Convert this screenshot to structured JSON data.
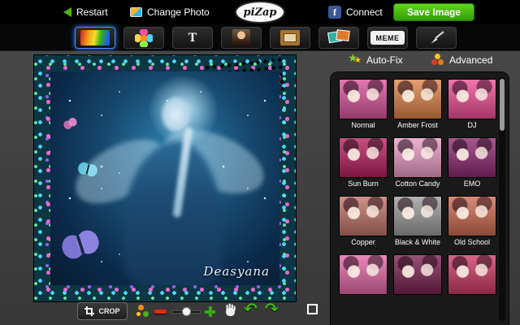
{
  "topbar": {
    "restart_label": "Restart",
    "change_photo_label": "Change Photo",
    "logo_text": "piZap",
    "facebook_letter": "f",
    "connect_label": "Connect",
    "save_label": "Save Image"
  },
  "toolbar": {
    "text_letter": "T",
    "meme_label": "MEME"
  },
  "canvas": {
    "signature": "Deasyana"
  },
  "effects_panel": {
    "autofix_label": "Auto-Fix",
    "advanced_label": "Advanced",
    "star_glyph": "★",
    "filters": [
      {
        "name": "Normal",
        "tint": "#d9549b"
      },
      {
        "name": "Amber Frost",
        "tint": "#de8448"
      },
      {
        "name": "DJ",
        "tint": "#ef4f96"
      },
      {
        "name": "Sun Burn",
        "tint": "#b5215f"
      },
      {
        "name": "Cotton Candy",
        "tint": "#eb9cc4"
      },
      {
        "name": "EMO",
        "tint": "#8e2a70"
      },
      {
        "name": "Copper",
        "tint": "#bf7468"
      },
      {
        "name": "Black & White",
        "tint": "#9b9b9b"
      },
      {
        "name": "Old School",
        "tint": "#cd6b52"
      },
      {
        "name": "",
        "tint": "#e468a8"
      },
      {
        "name": "",
        "tint": "#7a2250"
      },
      {
        "name": "",
        "tint": "#cc3a66"
      }
    ]
  },
  "bottombar": {
    "crop_label": "CROP",
    "undo_glyph": "↶",
    "redo_glyph": "↷"
  },
  "colors": {
    "save_green": "#3fae10",
    "facebook_blue": "#3b5998",
    "selected_tool_glow": "#4a90ff",
    "undo_green": "#3fb312"
  }
}
